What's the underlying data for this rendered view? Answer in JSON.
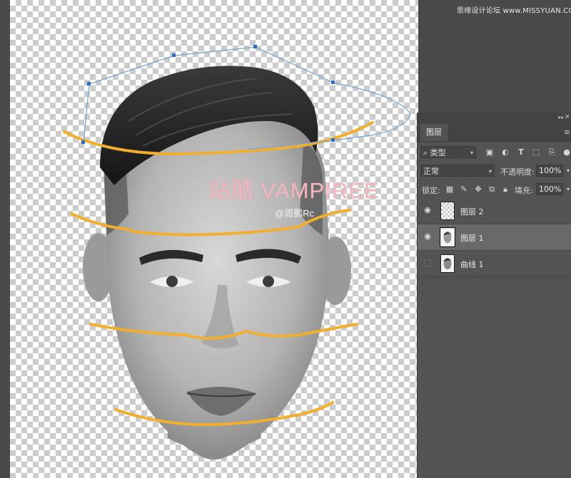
{
  "watermarks": {
    "site": "思缘设计论坛 www.MISSYUAN.COM",
    "main": "站酷 VAMPIREE",
    "sub": "@周鹏Rc"
  },
  "colors": {
    "guide_stroke": "#f2ae2e",
    "path_stroke": "#7aa7d6",
    "panel_bg": "#535353",
    "selected_row": "#696969"
  },
  "panel": {
    "tab_label": "图层",
    "collapse_icon": "double-chevron-right-icon",
    "close_icon": "close-icon",
    "menu_icon": "hamburger-menu-icon",
    "filter": {
      "search_glyph": "⌕",
      "kind_value": "类型",
      "icons": [
        "image-filter-icon",
        "adjustment-filter-icon",
        "text-filter-icon",
        "shape-filter-icon",
        "smartobject-filter-icon"
      ]
    },
    "blend_mode": "正常",
    "opacity_label": "不透明度:",
    "opacity_value": "100%",
    "lock_label": "锁定:",
    "fill_label": "填充:",
    "fill_value": "100%",
    "layers": [
      {
        "name": "图层 2",
        "visible": true,
        "selected": false,
        "thumb": "transparent"
      },
      {
        "name": "图层 1",
        "visible": true,
        "selected": true,
        "thumb": "face"
      },
      {
        "name": "曲线 1",
        "visible": false,
        "selected": false,
        "thumb": "face"
      }
    ]
  }
}
